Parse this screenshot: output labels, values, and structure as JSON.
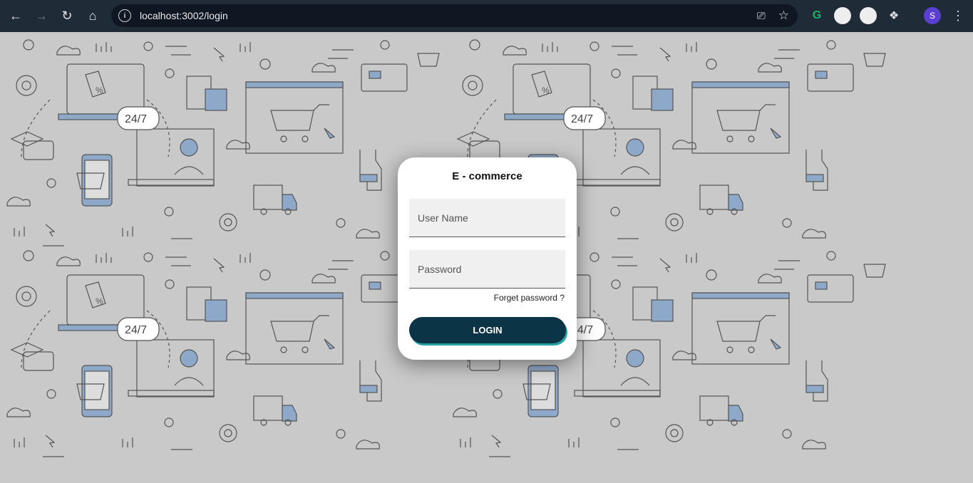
{
  "browser": {
    "url": "localhost:3002/login",
    "profile_initial": "S"
  },
  "login": {
    "title": "E - commerce",
    "username_placeholder": "User Name",
    "password_placeholder": "Password",
    "forgot_label": "Forget password ?",
    "login_label": "LOGIN"
  },
  "pattern": {
    "support_label": "24/7",
    "accent_color": "#8da8c8"
  }
}
